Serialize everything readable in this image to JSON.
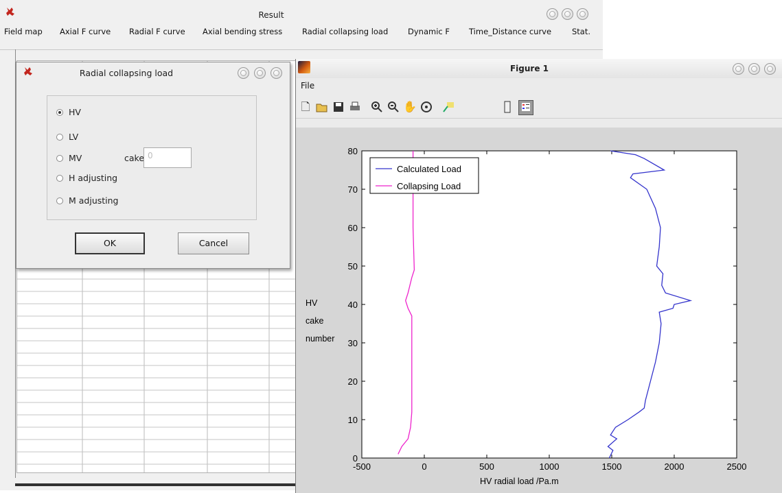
{
  "result_window": {
    "title": "Result",
    "menu": [
      "Field map",
      "Axial F curve",
      "Radial F curve",
      "Axial bending stress",
      "Radial collapsing load",
      "Dynamic F",
      "Time_Distance curve",
      "Stat."
    ]
  },
  "dialog": {
    "title": "Radial collapsing load",
    "options": [
      {
        "label": "HV",
        "checked": true
      },
      {
        "label": "LV",
        "checked": false
      },
      {
        "label": "MV",
        "checked": false
      },
      {
        "label": "H adjusting",
        "checked": false
      },
      {
        "label": "M adjusting",
        "checked": false
      }
    ],
    "cake_label": "cake",
    "cake_value": "0",
    "ok_label": "OK",
    "cancel_label": "Cancel"
  },
  "figure_window": {
    "title": "Figure 1",
    "menu_file": "File",
    "toolbar_icons": [
      "new-file-icon",
      "open-folder-icon",
      "save-icon",
      "print-icon",
      "zoom-in-icon",
      "zoom-out-icon",
      "pan-hand-icon",
      "rotate-3d-icon",
      "data-cursor-icon",
      "colorbar-icon",
      "legend-icon"
    ]
  },
  "chart_data": {
    "type": "line",
    "xlabel": "HV radial load   /Pa.m",
    "ylabel": [
      "HV",
      "cake",
      "number"
    ],
    "xlim": [
      -500,
      2500
    ],
    "ylim": [
      0,
      80
    ],
    "xticks": [
      -500,
      0,
      500,
      1000,
      1500,
      2000,
      2500
    ],
    "yticks": [
      0,
      10,
      20,
      30,
      40,
      50,
      60,
      70,
      80
    ],
    "legend_position": "top-left",
    "series": [
      {
        "name": "Calculated Load",
        "color": "#3333cc",
        "points": [
          [
            1480,
            0
          ],
          [
            1510,
            2
          ],
          [
            1470,
            3
          ],
          [
            1540,
            5
          ],
          [
            1490,
            6
          ],
          [
            1530,
            8
          ],
          [
            1630,
            10
          ],
          [
            1720,
            12
          ],
          [
            1760,
            13
          ],
          [
            1770,
            15
          ],
          [
            1810,
            20
          ],
          [
            1850,
            25
          ],
          [
            1880,
            30
          ],
          [
            1895,
            35
          ],
          [
            1880,
            38
          ],
          [
            1990,
            39
          ],
          [
            2000,
            40
          ],
          [
            2130,
            41
          ],
          [
            1930,
            43
          ],
          [
            1900,
            45
          ],
          [
            1910,
            48
          ],
          [
            1860,
            50
          ],
          [
            1880,
            55
          ],
          [
            1890,
            60
          ],
          [
            1850,
            65
          ],
          [
            1780,
            70
          ],
          [
            1650,
            73
          ],
          [
            1670,
            74
          ],
          [
            1920,
            75
          ],
          [
            1760,
            78
          ],
          [
            1690,
            79
          ],
          [
            1490,
            80
          ]
        ]
      },
      {
        "name": "Collapsing Load",
        "color": "#ee22cc",
        "points": [
          [
            -210,
            1
          ],
          [
            -180,
            3
          ],
          [
            -130,
            5
          ],
          [
            -110,
            8
          ],
          [
            -100,
            12
          ],
          [
            -100,
            25
          ],
          [
            -100,
            37
          ],
          [
            -130,
            39
          ],
          [
            -150,
            41
          ],
          [
            -130,
            43
          ],
          [
            -100,
            47
          ],
          [
            -80,
            49
          ],
          [
            -90,
            60
          ],
          [
            -90,
            80
          ]
        ]
      }
    ]
  }
}
